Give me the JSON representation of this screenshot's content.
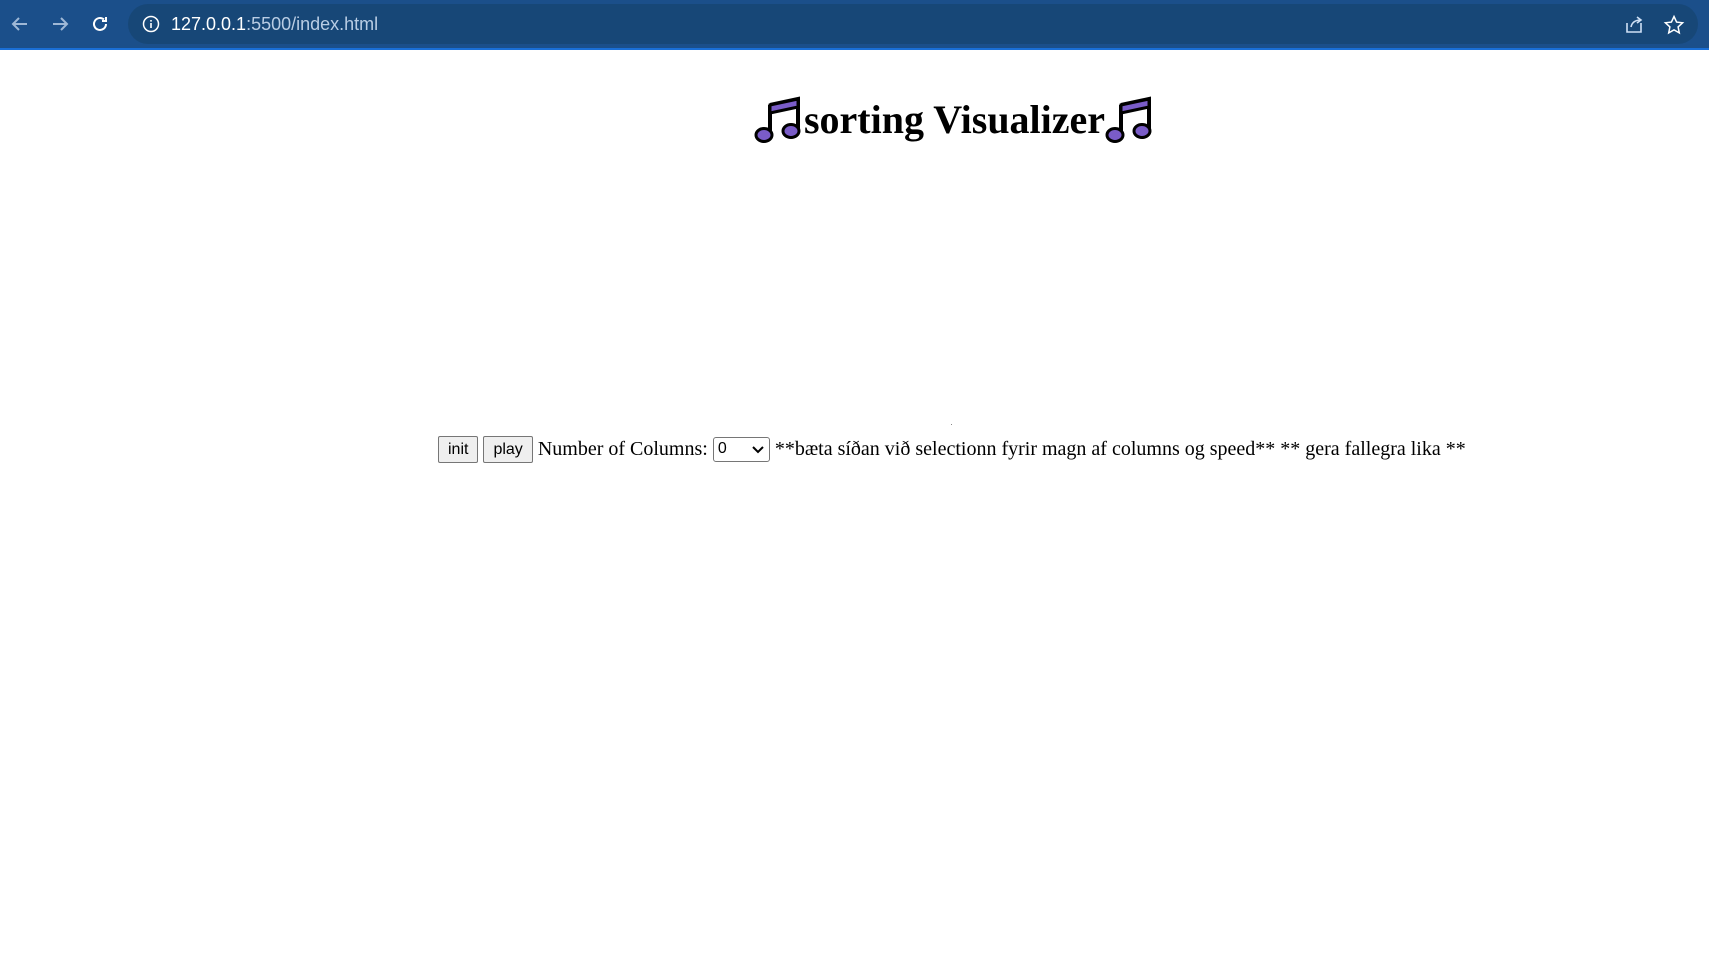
{
  "browser": {
    "url_host": "127.0.0.1",
    "url_rest": ":5500/index.html",
    "icons": [
      "back-arrow-icon",
      "forward-arrow-icon",
      "reload-icon",
      "info-icon",
      "share-icon",
      "star-icon"
    ]
  },
  "page": {
    "title": "sorting Visualizer",
    "title_icon": "music-note-icon",
    "note_color": "#7a5cc8"
  },
  "controls": {
    "init_label": "init",
    "play_label": "play",
    "columns_label": "Number of Columns:",
    "columns_value": "0",
    "todo_note": "**bæta síðan við selectionn fyrir magn af columns og speed** ** gera fallegra lika **"
  }
}
